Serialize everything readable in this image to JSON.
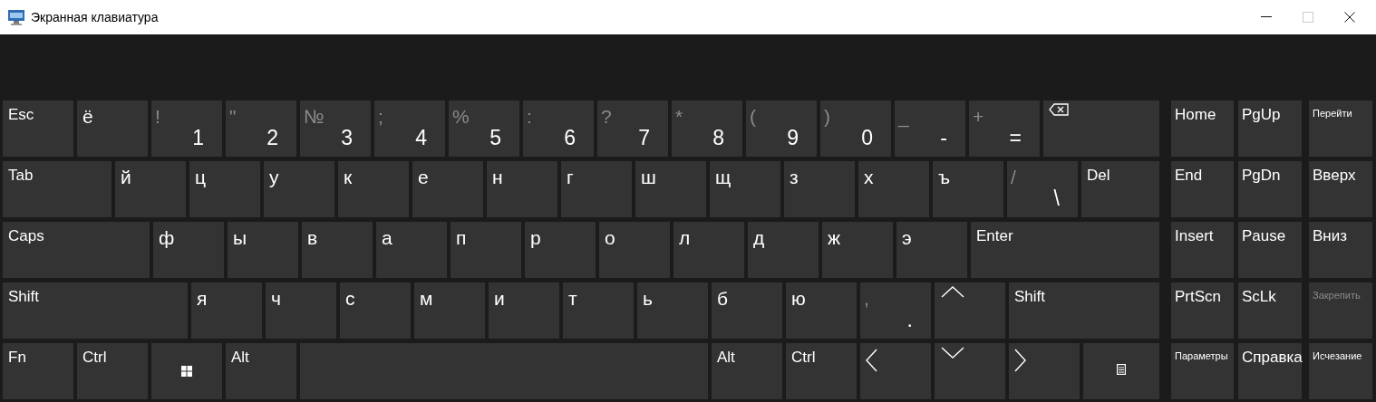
{
  "window": {
    "title": "Экранная клавиатура",
    "controls": [
      {
        "kind": "minimize",
        "disabled": false
      },
      {
        "kind": "maximize",
        "disabled": true
      },
      {
        "kind": "close",
        "disabled": false
      }
    ]
  },
  "keyboard": {
    "rows": [
      {
        "keys": [
          {
            "kind": "label",
            "label": "Esc"
          },
          {
            "kind": "char",
            "label": "ё"
          },
          {
            "kind": "dual",
            "upper": "!",
            "lower": "1"
          },
          {
            "kind": "dual",
            "upper": "\"",
            "lower": "2"
          },
          {
            "kind": "dual",
            "upper": "№",
            "lower": "3"
          },
          {
            "kind": "dual",
            "upper": ";",
            "lower": "4"
          },
          {
            "kind": "dual",
            "upper": "%",
            "lower": "5"
          },
          {
            "kind": "dual",
            "upper": ":",
            "lower": "6"
          },
          {
            "kind": "dual",
            "upper": "?",
            "lower": "7"
          },
          {
            "kind": "dual",
            "upper": "*",
            "lower": "8"
          },
          {
            "kind": "dual",
            "upper": "(",
            "lower": "9"
          },
          {
            "kind": "dual",
            "upper": ")",
            "lower": "0"
          },
          {
            "kind": "dual",
            "upper": "_",
            "lower": "-"
          },
          {
            "kind": "dual",
            "upper": "+",
            "lower": "="
          },
          {
            "kind": "backspace"
          }
        ]
      },
      {
        "keys": [
          {
            "kind": "label",
            "label": "Tab"
          },
          {
            "kind": "char",
            "label": "й"
          },
          {
            "kind": "char",
            "label": "ц"
          },
          {
            "kind": "char",
            "label": "у"
          },
          {
            "kind": "char",
            "label": "к"
          },
          {
            "kind": "char",
            "label": "е"
          },
          {
            "kind": "char",
            "label": "н"
          },
          {
            "kind": "char",
            "label": "г"
          },
          {
            "kind": "char",
            "label": "ш"
          },
          {
            "kind": "char",
            "label": "щ"
          },
          {
            "kind": "char",
            "label": "з"
          },
          {
            "kind": "char",
            "label": "х"
          },
          {
            "kind": "char",
            "label": "ъ"
          },
          {
            "kind": "dual",
            "upper": "/",
            "lower": "\\"
          },
          {
            "kind": "wide",
            "label": "Del"
          }
        ]
      },
      {
        "keys": [
          {
            "kind": "label",
            "label": "Caps"
          },
          {
            "kind": "char",
            "label": "ф"
          },
          {
            "kind": "char",
            "label": "ы"
          },
          {
            "kind": "char",
            "label": "в"
          },
          {
            "kind": "char",
            "label": "а"
          },
          {
            "kind": "char",
            "label": "п"
          },
          {
            "kind": "char",
            "label": "р"
          },
          {
            "kind": "char",
            "label": "о"
          },
          {
            "kind": "char",
            "label": "л"
          },
          {
            "kind": "char",
            "label": "д"
          },
          {
            "kind": "char",
            "label": "ж"
          },
          {
            "kind": "char",
            "label": "э"
          },
          {
            "kind": "wide",
            "label": "Enter"
          }
        ]
      },
      {
        "keys": [
          {
            "kind": "label",
            "label": "Shift"
          },
          {
            "kind": "char",
            "label": "я"
          },
          {
            "kind": "char",
            "label": "ч"
          },
          {
            "kind": "char",
            "label": "с"
          },
          {
            "kind": "char",
            "label": "м"
          },
          {
            "kind": "char",
            "label": "и"
          },
          {
            "kind": "char",
            "label": "т"
          },
          {
            "kind": "char",
            "label": "ь"
          },
          {
            "kind": "char",
            "label": "б"
          },
          {
            "kind": "char",
            "label": "ю"
          },
          {
            "kind": "dual",
            "upper": ",",
            "lower": "."
          },
          {
            "kind": "arrow-up"
          },
          {
            "kind": "wide",
            "label": "Shift"
          }
        ]
      },
      {
        "keys": [
          {
            "kind": "label",
            "label": "Fn"
          },
          {
            "kind": "label",
            "label": "Ctrl"
          },
          {
            "kind": "windows"
          },
          {
            "kind": "label",
            "label": "Alt"
          },
          {
            "kind": "space"
          },
          {
            "kind": "label",
            "label": "Alt"
          },
          {
            "kind": "label",
            "label": "Ctrl"
          },
          {
            "kind": "arrow-left"
          },
          {
            "kind": "arrow-down"
          },
          {
            "kind": "arrow-right"
          },
          {
            "kind": "menu"
          }
        ]
      }
    ]
  },
  "side_panel": {
    "rows": [
      [
        {
          "kind": "key",
          "label": "Home",
          "disabled": false
        },
        {
          "kind": "key",
          "label": "PgUp",
          "disabled": false
        },
        {
          "kind": "option",
          "label": "Перейти",
          "disabled": false
        }
      ],
      [
        {
          "kind": "key",
          "label": "End",
          "disabled": false
        },
        {
          "kind": "key",
          "label": "PgDn",
          "disabled": false
        },
        {
          "kind": "key",
          "label": "Вверх",
          "disabled": false
        }
      ],
      [
        {
          "kind": "key",
          "label": "Insert",
          "disabled": false
        },
        {
          "kind": "key",
          "label": "Pause",
          "disabled": false
        },
        {
          "kind": "key",
          "label": "Вниз",
          "disabled": false
        }
      ],
      [
        {
          "kind": "key",
          "label": "PrtScn",
          "disabled": false
        },
        {
          "kind": "key",
          "label": "ScLk",
          "disabled": false
        },
        {
          "kind": "option",
          "label": "Закрепить",
          "disabled": true
        }
      ],
      [
        {
          "kind": "option",
          "label": "Параметры",
          "disabled": false
        },
        {
          "kind": "key",
          "label": "Справка",
          "disabled": false
        },
        {
          "kind": "option",
          "label": "Исчезание",
          "disabled": false
        }
      ]
    ]
  }
}
